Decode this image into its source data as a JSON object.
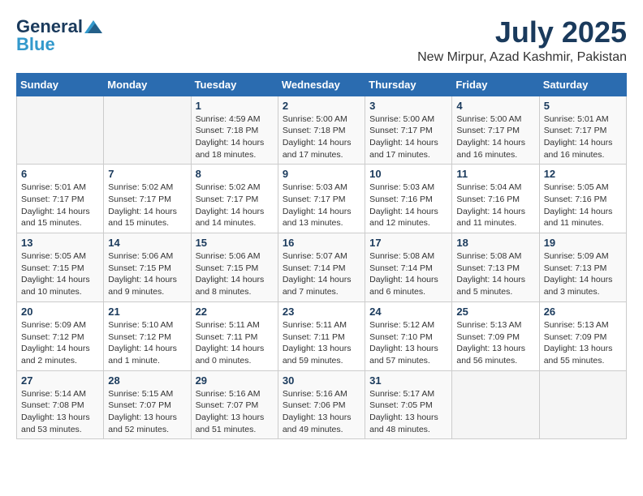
{
  "logo": {
    "part1": "General",
    "part2": "Blue"
  },
  "title": "July 2025",
  "location": "New Mirpur, Azad Kashmir, Pakistan",
  "days_of_week": [
    "Sunday",
    "Monday",
    "Tuesday",
    "Wednesday",
    "Thursday",
    "Friday",
    "Saturday"
  ],
  "weeks": [
    [
      {
        "day": "",
        "info": ""
      },
      {
        "day": "",
        "info": ""
      },
      {
        "day": "1",
        "info": "Sunrise: 4:59 AM\nSunset: 7:18 PM\nDaylight: 14 hours and 18 minutes."
      },
      {
        "day": "2",
        "info": "Sunrise: 5:00 AM\nSunset: 7:18 PM\nDaylight: 14 hours and 17 minutes."
      },
      {
        "day": "3",
        "info": "Sunrise: 5:00 AM\nSunset: 7:17 PM\nDaylight: 14 hours and 17 minutes."
      },
      {
        "day": "4",
        "info": "Sunrise: 5:00 AM\nSunset: 7:17 PM\nDaylight: 14 hours and 16 minutes."
      },
      {
        "day": "5",
        "info": "Sunrise: 5:01 AM\nSunset: 7:17 PM\nDaylight: 14 hours and 16 minutes."
      }
    ],
    [
      {
        "day": "6",
        "info": "Sunrise: 5:01 AM\nSunset: 7:17 PM\nDaylight: 14 hours and 15 minutes."
      },
      {
        "day": "7",
        "info": "Sunrise: 5:02 AM\nSunset: 7:17 PM\nDaylight: 14 hours and 15 minutes."
      },
      {
        "day": "8",
        "info": "Sunrise: 5:02 AM\nSunset: 7:17 PM\nDaylight: 14 hours and 14 minutes."
      },
      {
        "day": "9",
        "info": "Sunrise: 5:03 AM\nSunset: 7:17 PM\nDaylight: 14 hours and 13 minutes."
      },
      {
        "day": "10",
        "info": "Sunrise: 5:03 AM\nSunset: 7:16 PM\nDaylight: 14 hours and 12 minutes."
      },
      {
        "day": "11",
        "info": "Sunrise: 5:04 AM\nSunset: 7:16 PM\nDaylight: 14 hours and 11 minutes."
      },
      {
        "day": "12",
        "info": "Sunrise: 5:05 AM\nSunset: 7:16 PM\nDaylight: 14 hours and 11 minutes."
      }
    ],
    [
      {
        "day": "13",
        "info": "Sunrise: 5:05 AM\nSunset: 7:15 PM\nDaylight: 14 hours and 10 minutes."
      },
      {
        "day": "14",
        "info": "Sunrise: 5:06 AM\nSunset: 7:15 PM\nDaylight: 14 hours and 9 minutes."
      },
      {
        "day": "15",
        "info": "Sunrise: 5:06 AM\nSunset: 7:15 PM\nDaylight: 14 hours and 8 minutes."
      },
      {
        "day": "16",
        "info": "Sunrise: 5:07 AM\nSunset: 7:14 PM\nDaylight: 14 hours and 7 minutes."
      },
      {
        "day": "17",
        "info": "Sunrise: 5:08 AM\nSunset: 7:14 PM\nDaylight: 14 hours and 6 minutes."
      },
      {
        "day": "18",
        "info": "Sunrise: 5:08 AM\nSunset: 7:13 PM\nDaylight: 14 hours and 5 minutes."
      },
      {
        "day": "19",
        "info": "Sunrise: 5:09 AM\nSunset: 7:13 PM\nDaylight: 14 hours and 3 minutes."
      }
    ],
    [
      {
        "day": "20",
        "info": "Sunrise: 5:09 AM\nSunset: 7:12 PM\nDaylight: 14 hours and 2 minutes."
      },
      {
        "day": "21",
        "info": "Sunrise: 5:10 AM\nSunset: 7:12 PM\nDaylight: 14 hours and 1 minute."
      },
      {
        "day": "22",
        "info": "Sunrise: 5:11 AM\nSunset: 7:11 PM\nDaylight: 14 hours and 0 minutes."
      },
      {
        "day": "23",
        "info": "Sunrise: 5:11 AM\nSunset: 7:11 PM\nDaylight: 13 hours and 59 minutes."
      },
      {
        "day": "24",
        "info": "Sunrise: 5:12 AM\nSunset: 7:10 PM\nDaylight: 13 hours and 57 minutes."
      },
      {
        "day": "25",
        "info": "Sunrise: 5:13 AM\nSunset: 7:09 PM\nDaylight: 13 hours and 56 minutes."
      },
      {
        "day": "26",
        "info": "Sunrise: 5:13 AM\nSunset: 7:09 PM\nDaylight: 13 hours and 55 minutes."
      }
    ],
    [
      {
        "day": "27",
        "info": "Sunrise: 5:14 AM\nSunset: 7:08 PM\nDaylight: 13 hours and 53 minutes."
      },
      {
        "day": "28",
        "info": "Sunrise: 5:15 AM\nSunset: 7:07 PM\nDaylight: 13 hours and 52 minutes."
      },
      {
        "day": "29",
        "info": "Sunrise: 5:16 AM\nSunset: 7:07 PM\nDaylight: 13 hours and 51 minutes."
      },
      {
        "day": "30",
        "info": "Sunrise: 5:16 AM\nSunset: 7:06 PM\nDaylight: 13 hours and 49 minutes."
      },
      {
        "day": "31",
        "info": "Sunrise: 5:17 AM\nSunset: 7:05 PM\nDaylight: 13 hours and 48 minutes."
      },
      {
        "day": "",
        "info": ""
      },
      {
        "day": "",
        "info": ""
      }
    ]
  ]
}
